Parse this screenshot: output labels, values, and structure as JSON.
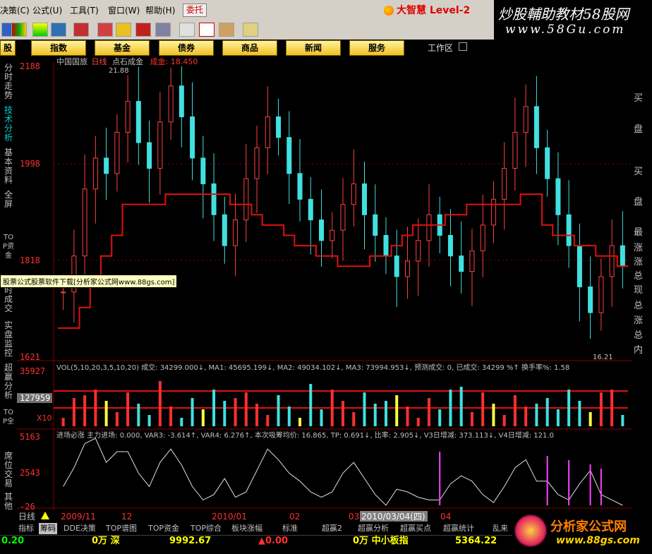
{
  "menu": {
    "items": [
      "决策(C)",
      "公式(U)",
      "工具(T)",
      "窗口(W)",
      "帮助(H)"
    ],
    "weituo": "委托",
    "brand": "大智慧 Level-2"
  },
  "banner": {
    "line1": "炒股輔助教材58股网",
    "line2": "www.58Gu.com"
  },
  "nav": {
    "buttons": [
      "股",
      "指数",
      "基金",
      "债券",
      "商品",
      "新闻",
      "服务"
    ],
    "workspace": "工作区"
  },
  "leftbar": {
    "tabs": [
      "分时走势",
      "技术分析",
      "基本资料",
      "全屏",
      "TOP资金",
      "时成交",
      "实盘监控",
      "超赢分析",
      "TOP全",
      "席位交易",
      "其他"
    ]
  },
  "main_chart": {
    "title_parts": [
      "中国国旅",
      "日线",
      "点石成金",
      "成金: 18.450"
    ],
    "price_levels": [
      "2188",
      "1998",
      "1818",
      "1621"
    ],
    "high_label": "21.88",
    "low_label": "16.21"
  },
  "vol_panel": {
    "header": "VOL(5,10,20,3,5,10,20) 成交: 34299.000↓, MA1: 45695.199↓, MA2: 49034.102↓, MA3: 73994.953↓, 预测成交: 0, 已成交: 34299 %↑ 换手率%: 1.58",
    "levels": [
      "35927",
      "127959",
      "X10"
    ]
  },
  "ind_panel": {
    "header": "进场必涨 主力进场: 0.000, VAR3: -3.614↑, VAR4: 6.276↑, 本次吸筹均价: 16.865, TP: 0.691↓, 比率: 2.905↓, V3日增减: 373.113↓, V4日增减: 121.0",
    "levels": [
      "5163",
      "2543",
      "-26"
    ]
  },
  "date_axis": {
    "labels": [
      "2009/11",
      "12",
      "2010/01",
      "02",
      "03",
      "2010/03/04(四)",
      "04"
    ],
    "period": "日线"
  },
  "tooltip": "股票公式股票软件下载[分析家公式网www.88gs.com]",
  "bottom_tabs": [
    "指标",
    "筹码",
    "DDE决策",
    "TOP谱图",
    "TOP资金",
    "TOP综合",
    "板块涨幅",
    "标准",
    "超赢2",
    "超赢分析",
    "超赢买点",
    "超赢统计",
    "乱来"
  ],
  "status": {
    "s1": "0.20",
    "s2": "0万 深",
    "s3": "9992.67",
    "s4": "▲0.00",
    "s5": "0万 中小板指",
    "s6": "5364.22"
  },
  "rightcol": [
    "买",
    "盘",
    "买",
    "盘",
    "最",
    "涨",
    "涨",
    "总",
    "现",
    "总",
    "涨",
    "总",
    "内"
  ],
  "logo88": {
    "line1": "分析家公式网",
    "line2": "www.88gs.com"
  },
  "chart_data": {
    "type": "candlestick",
    "title": "中国国旅 日线",
    "ylim": [
      16.21,
      21.88
    ],
    "series": [
      {
        "name": "收盘价",
        "values": [
          17.5,
          18.2,
          19.5,
          20.1,
          19.8,
          20.6,
          21.2,
          20.4,
          19.9,
          20.8,
          21.5,
          20.9,
          20.1,
          19.6,
          19.0,
          18.4,
          18.9,
          19.7,
          20.3,
          20.9,
          20.5,
          19.8,
          19.3,
          18.9,
          18.5,
          18.7,
          19.2,
          19.6,
          19.0,
          18.6,
          18.2,
          17.8,
          18.1,
          18.5,
          19.0,
          18.6,
          18.2,
          17.9,
          18.3,
          18.8,
          19.3,
          19.9,
          20.6,
          21.1,
          20.3,
          19.7,
          19.0,
          18.4,
          17.6,
          17.1,
          17.8,
          18.4,
          18.0
        ]
      },
      {
        "name": "点石成金",
        "values": [
          16.8,
          16.8,
          17.2,
          17.6,
          18.2,
          18.6,
          19.2,
          19.2,
          19.2,
          19.2,
          19.4,
          19.4,
          19.4,
          19.4,
          19.4,
          19.4,
          19.2,
          19.2,
          19.0,
          18.8,
          18.8,
          18.6,
          18.4,
          18.4,
          18.2,
          18.2,
          18.0,
          18.0,
          18.0,
          18.2,
          18.2,
          18.4,
          18.6,
          18.8,
          18.8,
          18.8,
          19.0,
          19.0,
          19.2,
          19.2,
          19.2,
          19.2,
          19.2,
          19.4,
          19.4,
          18.8,
          18.6,
          18.6,
          18.4,
          18.4,
          18.2,
          18.2,
          18.0
        ]
      }
    ],
    "volume_ma_levels": [
      "35927",
      "127959"
    ],
    "x_labels": [
      "2009/11",
      "12",
      "2010/01",
      "02",
      "03",
      "2010/03/04(四)",
      "04"
    ]
  }
}
